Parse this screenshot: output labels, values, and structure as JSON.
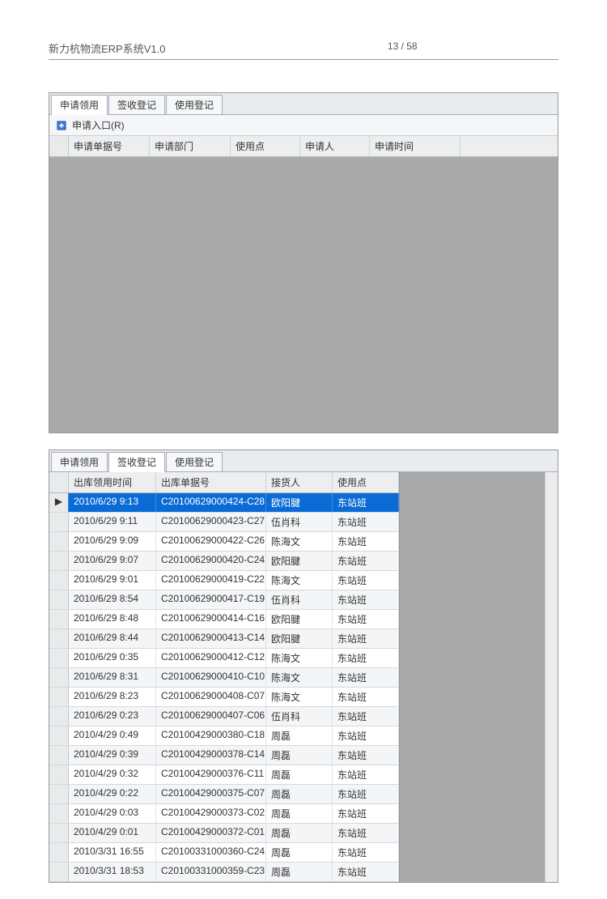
{
  "doc": {
    "title": "新力杭物流ERP系统V1.0",
    "pager": "13 / 58"
  },
  "panel1": {
    "tabs": [
      "申请领用",
      "签收登记",
      "使用登记"
    ],
    "active_tab": 0,
    "toolbar": {
      "entry_label": "申请入口(R)"
    },
    "columns": [
      "申请单据号",
      "申请部门",
      "使用点",
      "申请人",
      "申请时间"
    ],
    "rows": []
  },
  "panel2": {
    "tabs": [
      "申请领用",
      "签收登记",
      "使用登记"
    ],
    "active_tab": 1,
    "columns": [
      "出库领用时间",
      "出库单据号",
      "接货人",
      "使用点"
    ],
    "rows": [
      {
        "time": "2010/6/29 9:13",
        "docno": "C20100629000424-C28",
        "receiver": "欧阳腱",
        "loc": "东站班",
        "sel": true
      },
      {
        "time": "2010/6/29 9:11",
        "docno": "C20100629000423-C27",
        "receiver": "伍肖科",
        "loc": "东站班"
      },
      {
        "time": "2010/6/29 9:09",
        "docno": "C20100629000422-C26",
        "receiver": "陈海文",
        "loc": "东站班"
      },
      {
        "time": "2010/6/29 9:07",
        "docno": "C20100629000420-C24",
        "receiver": "欧阳腱",
        "loc": "东站班"
      },
      {
        "time": "2010/6/29 9:01",
        "docno": "C20100629000419-C22",
        "receiver": "陈海文",
        "loc": "东站班"
      },
      {
        "time": "2010/6/29 8:54",
        "docno": "C20100629000417-C19",
        "receiver": "伍肖科",
        "loc": "东站班"
      },
      {
        "time": "2010/6/29 8:48",
        "docno": "C20100629000414-C16",
        "receiver": "欧阳腱",
        "loc": "东站班"
      },
      {
        "time": "2010/6/29 8:44",
        "docno": "C20100629000413-C14",
        "receiver": "欧阳腱",
        "loc": "东站班"
      },
      {
        "time": "2010/6/29 0:35",
        "docno": "C20100629000412-C12",
        "receiver": "陈海文",
        "loc": "东站班"
      },
      {
        "time": "2010/6/29 8:31",
        "docno": "C20100629000410-C10",
        "receiver": "陈海文",
        "loc": "东站班"
      },
      {
        "time": "2010/6/29 8:23",
        "docno": "C20100629000408-C07",
        "receiver": "陈海文",
        "loc": "东站班"
      },
      {
        "time": "2010/6/29 0:23",
        "docno": "C20100629000407-C06",
        "receiver": "伍肖科",
        "loc": "东站班"
      },
      {
        "time": "2010/4/29 0:49",
        "docno": "C20100429000380-C18",
        "receiver": "周磊",
        "loc": "东站班"
      },
      {
        "time": "2010/4/29 0:39",
        "docno": "C20100429000378-C14",
        "receiver": "周磊",
        "loc": "东站班"
      },
      {
        "time": "2010/4/29 0:32",
        "docno": "C20100429000376-C11",
        "receiver": "周磊",
        "loc": "东站班"
      },
      {
        "time": "2010/4/29 0:22",
        "docno": "C20100429000375-C07",
        "receiver": "周磊",
        "loc": "东站班"
      },
      {
        "time": "2010/4/29 0:03",
        "docno": "C20100429000373-C02",
        "receiver": "周磊",
        "loc": "东站班"
      },
      {
        "time": "2010/4/29 0:01",
        "docno": "C20100429000372-C01",
        "receiver": "周磊",
        "loc": "东站班"
      },
      {
        "time": "2010/3/31 16:55",
        "docno": "C20100331000360-C24",
        "receiver": "周磊",
        "loc": "东站班"
      },
      {
        "time": "2010/3/31 18:53",
        "docno": "C20100331000359-C23",
        "receiver": "周磊",
        "loc": "东站班"
      }
    ]
  }
}
